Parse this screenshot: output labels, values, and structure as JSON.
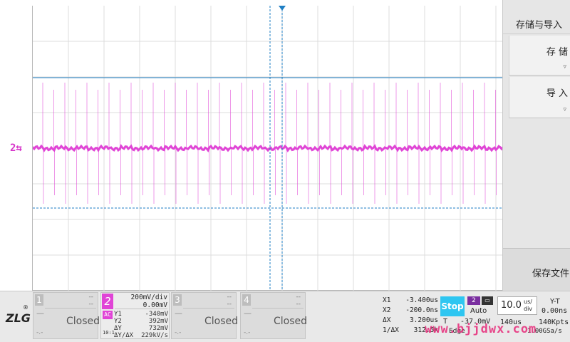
{
  "menu": {
    "title": "存储与导入",
    "save": "存 储",
    "import": "导 入",
    "save_file": "保存文件",
    "arrow": "▿"
  },
  "channel_marker": "2⇆",
  "channels": [
    {
      "num": "1",
      "dash1": "--",
      "dash2": "--",
      "minus": "—",
      "state": "Closed",
      "lowdash": "-.-"
    },
    {
      "num": "3",
      "dash1": "--",
      "dash2": "--",
      "minus": "—",
      "state": "Closed",
      "lowdash": "-.-"
    },
    {
      "num": "4",
      "dash1": "--",
      "dash2": "--",
      "minus": "—",
      "state": "Closed",
      "lowdash": "-.-"
    }
  ],
  "ch2": {
    "num": "2",
    "scale": "200mV/div",
    "offset": "0.00mV",
    "coupling": "AC",
    "bw": "10:1",
    "y1_label": "Y1",
    "y1": "-340mV",
    "y2_label": "Y2",
    "y2": "392mV",
    "dy_label": "ΔY",
    "dy": "732mV",
    "dydx_label": "ΔY/ΔX",
    "dydx": "229kV/s"
  },
  "cursors": {
    "x1_label": "X1",
    "x1": "-3.400us",
    "x2_label": "X2",
    "x2": "-200.0ns",
    "dx_label": "ΔX",
    "dx": "3.200us",
    "invdx_label": "1/ΔX",
    "invdx": "312.5k"
  },
  "trigger": {
    "run_state": "Stop",
    "source": "2",
    "edge": "▭",
    "mode": "Auto",
    "t_label": "T",
    "level": "-37.0mV",
    "edge_label": "Edge"
  },
  "timebase": {
    "value": "10.0",
    "unit_top": "us/",
    "unit_bottom": "div",
    "mode": "Y-T",
    "hpos": "0.00ns",
    "delay": "140us",
    "memory": "140Kpts",
    "sample_rate": "1.00GSa/s"
  },
  "watermark": "www.bjjdwx.com",
  "colors": {
    "ch2": "#e044d6",
    "cursor": "#1f7fc4",
    "stop": "#2ec6f1"
  }
}
